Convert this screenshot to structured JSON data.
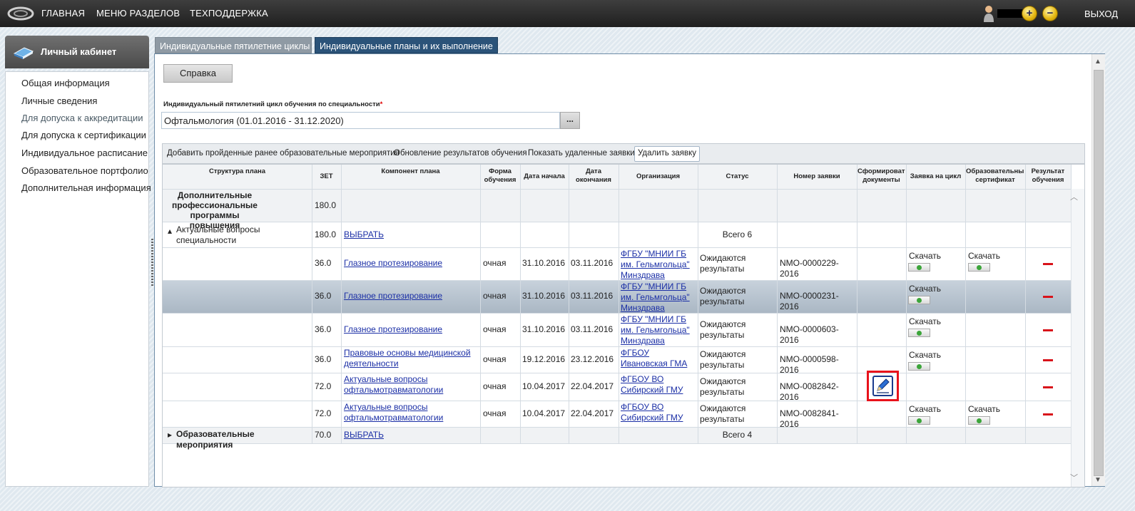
{
  "topbar": {
    "nav": [
      "ГЛАВНАЯ",
      "МЕНЮ РАЗДЕЛОВ",
      "ТЕХПОДДЕРЖКА"
    ],
    "zoom_in": "+",
    "zoom_out": "−",
    "exit": "ВЫХОД"
  },
  "sidebar": {
    "title": "Личный кабинет",
    "items": [
      {
        "label": "Общая информация"
      },
      {
        "label": "Личные сведения"
      },
      {
        "label": "Для допуска к аккредитации"
      },
      {
        "label": "Для допуска к сертификации"
      },
      {
        "label": "Индивидуальное расписание"
      },
      {
        "label": "Образовательное портфолио"
      },
      {
        "label": "Дополнительная информация"
      }
    ]
  },
  "tabs": [
    "Индивидуальные пятилетние циклы",
    "Индивидуальные планы и их выполнение"
  ],
  "main": {
    "help_button": "Справка",
    "cycle_label": "Индивидуальный пятилетний цикл обучения по специальности",
    "cycle_required": "*",
    "cycle_value": "Офтальмология (01.01.2016 - 31.12.2020)",
    "cycle_btn": "...",
    "toolbar": [
      "Добавить пройденные ранее образовательные мероприятия",
      "Обновление результатов обучения",
      "Показать удаленные заявки",
      "Удалить заявку"
    ]
  },
  "grid": {
    "headers": [
      "Структура плана",
      "ЗЕТ",
      "Компонент плана",
      "Форма обучения",
      "Дата начала",
      "Дата окончания",
      "Организация",
      "Статус",
      "Номер заявки",
      "Сформировать документы",
      "Заявка на цикл",
      "Образовательный сертификат",
      "Результат обучения"
    ],
    "group_row": {
      "structure": "Дополнительные профессиональные программы повышения",
      "zet": "180.0"
    },
    "sub_row": {
      "toggle": "▴",
      "structure": "Актуальные вопросы специальности",
      "zet": "180.0",
      "component": "ВЫБРАТЬ",
      "total": "Всего 6"
    },
    "rows": [
      {
        "zet": "36.0",
        "component": "Глазное протезирование",
        "form": "очная",
        "start": "31.10.2016",
        "end": "03.11.2016",
        "org": "ФГБУ \"МНИИ ГБ им. Гельмгольца\" Минздрава",
        "status": "Ожидаются результаты",
        "number": "NMO-0000229-2016",
        "apply": "Скачать",
        "cert": "Скачать",
        "selected": false
      },
      {
        "zet": "36.0",
        "component": "Глазное протезирование",
        "form": "очная",
        "start": "31.10.2016",
        "end": "03.11.2016",
        "org": "ФГБУ \"МНИИ ГБ им. Гельмгольца\" Минздрава",
        "status": "Ожидаются результаты",
        "number": "NMO-0000231-2016",
        "apply": "Скачать",
        "cert": "",
        "selected": true
      },
      {
        "zet": "36.0",
        "component": "Глазное протезирование",
        "form": "очная",
        "start": "31.10.2016",
        "end": "03.11.2016",
        "org": "ФГБУ \"МНИИ ГБ им. Гельмгольца\" Минздрава",
        "status": "Ожидаются результаты",
        "number": "NMO-0000603-2016",
        "apply": "Скачать",
        "cert": "",
        "selected": false
      },
      {
        "zet": "36.0",
        "component": "Правовые основы медицинской деятельности",
        "form": "очная",
        "start": "19.12.2016",
        "end": "23.12.2016",
        "org": "ФГБОУ Ивановская ГМА",
        "status": "Ожидаются результаты",
        "number": "NMO-0000598-2016",
        "apply": "Скачать",
        "cert": "",
        "selected": false
      },
      {
        "zet": "72.0",
        "component": "Актуальные вопросы офтальмотравматологии",
        "form": "очная",
        "start": "10.04.2017",
        "end": "22.04.2017",
        "org": "ФГБОУ ВО Сибирский ГМУ",
        "status": "Ожидаются результаты",
        "number": "NMO-0082842-2016",
        "apply": "",
        "cert": "",
        "selected": false,
        "doc_icon": "pen-edit-icon"
      },
      {
        "zet": "72.0",
        "component": "Актуальные вопросы офтальмотравматологии",
        "form": "очная",
        "start": "10.04.2017",
        "end": "22.04.2017",
        "org": "ФГБОУ ВО Сибирский ГМУ",
        "status": "Ожидаются результаты",
        "number": "NMO-0082841-2016",
        "apply": "Скачать",
        "cert": "Скачать",
        "selected": false
      }
    ],
    "bottom_row": {
      "toggle": "▸",
      "structure": "Образовательные мероприятия",
      "zet": "70.0",
      "component": "ВЫБРАТЬ",
      "total": "Всего 4"
    }
  },
  "colors": {
    "selected_row": "#c8d2dc",
    "tab_active": "#2b5379",
    "tab_inactive": "#8f9aa4",
    "link": "#1b2fa6",
    "delete": "#d8131a",
    "highlight_box": "#e8121b"
  }
}
